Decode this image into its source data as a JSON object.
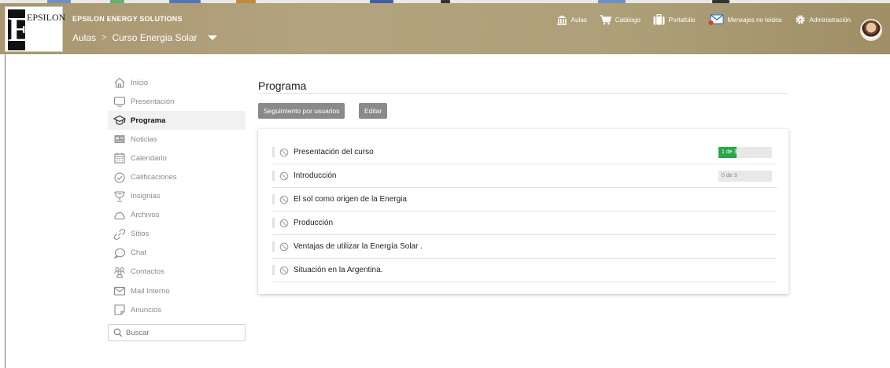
{
  "brand": {
    "logo_text": "EPSILON",
    "company": "EPSILON ENERGY SOLUTIONS"
  },
  "breadcrumb": {
    "root": "Aulas",
    "separator": ">",
    "current": "Curso Energia Solar"
  },
  "topnav": [
    {
      "label": "Aulas",
      "icon": "building-columns-icon"
    },
    {
      "label": "Catálogo",
      "icon": "cart-icon"
    },
    {
      "label": "Portafolio",
      "icon": "briefcase-icon"
    },
    {
      "label": "Mensajes no leídos",
      "icon": "envelope-icon"
    },
    {
      "label": "Administración",
      "icon": "gear-icon"
    }
  ],
  "sidebar": {
    "items": [
      {
        "label": "Inicio",
        "icon": "home-icon"
      },
      {
        "label": "Presentación",
        "icon": "monitor-icon"
      },
      {
        "label": "Programa",
        "icon": "graduation-cap-icon",
        "active": true
      },
      {
        "label": "Noticias",
        "icon": "newspaper-icon"
      },
      {
        "label": "Calendario",
        "icon": "calendar-icon"
      },
      {
        "label": "Calificaciones",
        "icon": "check-circle-icon"
      },
      {
        "label": "Insignias",
        "icon": "badge-icon"
      },
      {
        "label": "Archivos",
        "icon": "cloud-icon"
      },
      {
        "label": "Sitios",
        "icon": "link-icon"
      },
      {
        "label": "Chat",
        "icon": "chat-bubble-icon"
      },
      {
        "label": "Contactos",
        "icon": "contacts-icon"
      },
      {
        "label": "Mail Interno",
        "icon": "mail-icon"
      },
      {
        "label": "Anuncios",
        "icon": "note-icon"
      }
    ],
    "search_label": "Buscar"
  },
  "main": {
    "title": "Programa",
    "buttons": {
      "tracking": "Seguimiento por usuarios",
      "edit": "Editar"
    },
    "modules": [
      {
        "label": "Presentación del curso",
        "progress_text": "1 de 3",
        "progress_fraction": 0.333
      },
      {
        "label": "Introducción",
        "progress_text": "0 de 3",
        "progress_fraction": 0
      },
      {
        "label": "El sol como origen de la Energia"
      },
      {
        "label": "Producción"
      },
      {
        "label": "Ventajas de utilizar la Energía Solar ."
      },
      {
        "label": "Situación en la Argentina."
      }
    ]
  },
  "colors": {
    "header": "#b0a07b",
    "progress_fill": "#26a84a",
    "button": "#8a8a8a"
  }
}
